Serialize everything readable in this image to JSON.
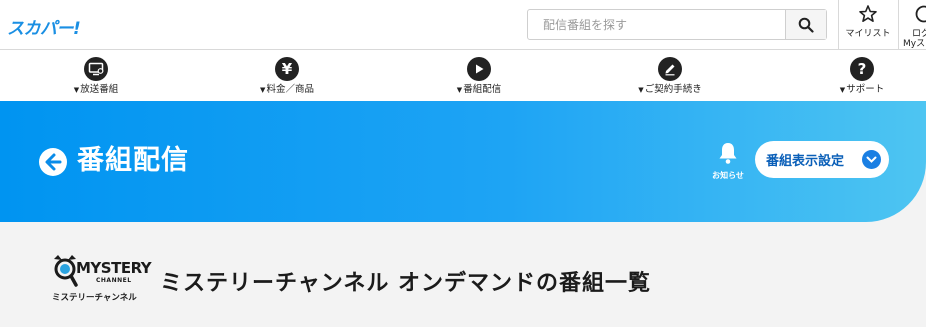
{
  "header": {
    "logo_text": "スカパー!",
    "search": {
      "placeholder": "配信番組を探す"
    },
    "mylist_label": "マイリスト",
    "login_label": "ログ",
    "login_sub": "Myスカ"
  },
  "nav": [
    {
      "label": "放送番組",
      "icon": "tv-icon"
    },
    {
      "label": "料金／商品",
      "icon": "yen-icon"
    },
    {
      "label": "番組配信",
      "icon": "play-icon"
    },
    {
      "label": "ご契約手続き",
      "icon": "pen-icon"
    },
    {
      "label": "サポート",
      "icon": "question-icon"
    }
  ],
  "banner": {
    "title": "番組配信",
    "notice_label": "お知らせ",
    "settings_label": "番組表示設定",
    "gradient": [
      "#0094f1",
      "#4ec5f2"
    ]
  },
  "channel": {
    "logo_word": "MYSTERY",
    "logo_sub": "CHANNEL",
    "logo_jp": "ミステリーチャンネル",
    "title": "ミステリーチャンネル オンデマンドの番組一覧"
  },
  "colors": {
    "accent": "#1a8fe3",
    "page_bg": "#f3f3f3"
  }
}
